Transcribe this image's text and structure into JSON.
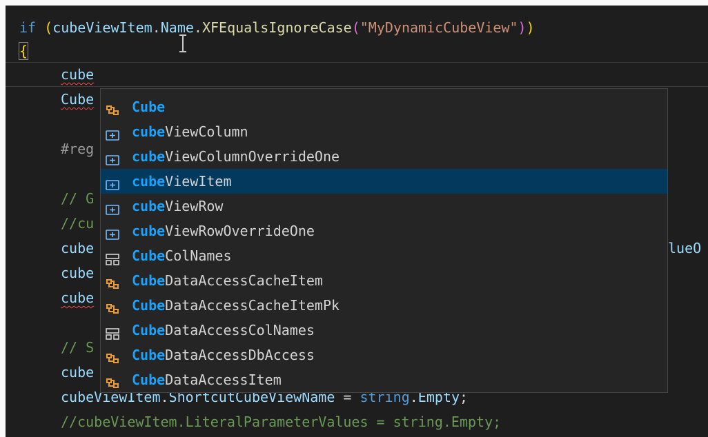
{
  "editor": {
    "lines": {
      "l1_if": "if",
      "l1_open": "(",
      "l1_var": "cubeViewItem",
      "l1_dot1": ".",
      "l1_prop": "Name",
      "l1_dot2": ".",
      "l1_method": "XFEqualsIgnoreCase",
      "l1_open2": "(",
      "l1_str": "\"MyDynamicCubeView\"",
      "l1_close2": ")",
      "l1_close": ")",
      "l2_brace": "{",
      "l3": "cube",
      "l4": "Cube",
      "l5": "#reg",
      "l6": "// G",
      "l7": "//cu",
      "l8": "cube",
      "l8_tail": "lueO",
      "l9": "cube",
      "l10": "cube",
      "l11": "// S",
      "l12": "cube",
      "l13_var": "cubeViewItem",
      "l13_dot": ".",
      "l13_prop": "ShortcutCubeViewName",
      "l13_eq": " = ",
      "l13_kw": "string",
      "l13_dot2": ".",
      "l13_empty": "Empty",
      "l13_semi": ";",
      "l14": "//cubeViewItem.LiteralParameterValues = string.Empty;"
    }
  },
  "suggest": {
    "items": [
      {
        "match": "Cube",
        "rest": "",
        "icon": "class-icon"
      },
      {
        "match": "cube",
        "rest": "ViewColumn",
        "icon": "variable-icon"
      },
      {
        "match": "cube",
        "rest": "ViewColumnOverrideOne",
        "icon": "variable-icon"
      },
      {
        "match": "cube",
        "rest": "ViewItem",
        "icon": "variable-icon",
        "selected": true
      },
      {
        "match": "cube",
        "rest": "ViewRow",
        "icon": "variable-icon"
      },
      {
        "match": "cube",
        "rest": "ViewRowOverrideOne",
        "icon": "variable-icon"
      },
      {
        "match": "Cube",
        "rest": "ColNames",
        "icon": "structure-icon"
      },
      {
        "match": "Cube",
        "rest": "DataAccessCacheItem",
        "icon": "class-icon"
      },
      {
        "match": "Cube",
        "rest": "DataAccessCacheItemPk",
        "icon": "class-icon"
      },
      {
        "match": "Cube",
        "rest": "DataAccessColNames",
        "icon": "structure-icon"
      },
      {
        "match": "Cube",
        "rest": "DataAccessDbAccess",
        "icon": "class-icon"
      },
      {
        "match": "Cube",
        "rest": "DataAccessItem",
        "icon": "class-icon"
      }
    ]
  },
  "colors": {
    "background": "#1e1e1e",
    "suggest_bg": "#252526",
    "selected_bg": "#04395e",
    "match_highlight": "#18a3ff",
    "class_icon": "#ee9d28",
    "variable_icon": "#75beff",
    "structure_icon": "#d4d4d4"
  }
}
